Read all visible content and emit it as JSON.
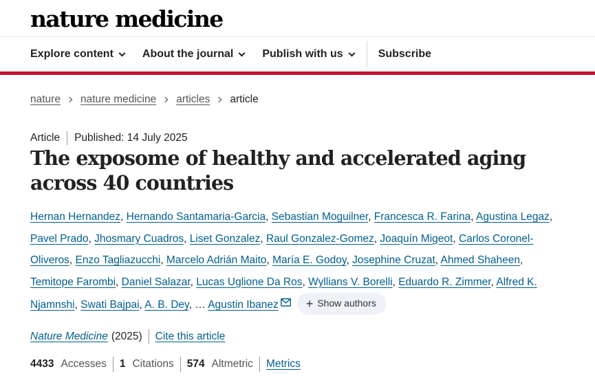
{
  "site": {
    "logo": "nature medicine"
  },
  "nav": {
    "items": [
      {
        "label": "Explore content"
      },
      {
        "label": "About the journal"
      },
      {
        "label": "Publish with us"
      }
    ],
    "subscribe": "Subscribe"
  },
  "breadcrumb": [
    "nature",
    "nature medicine",
    "articles",
    "article"
  ],
  "article": {
    "type": "Article",
    "published": "Published: 14 July 2025",
    "title": "The exposome of healthy and accelerated aging across 40 countries",
    "authors": [
      "Hernan Hernandez",
      "Hernando Santamaria-Garcia",
      "Sebastian Moguilner",
      "Francesca R. Farina",
      "Agustina Legaz",
      "Pavel Prado",
      "Jhosmary Cuadros",
      "Liset Gonzalez",
      "Raul Gonzalez-Gomez",
      "Joaquín Migeot",
      "Carlos Coronel-Oliveros",
      "Enzo Tagliazucchi",
      "Marcelo Adrián Maito",
      "María E. Godoy",
      "Josephine Cruzat",
      "Ahmed Shaheen",
      "Temitope Farombi",
      "Daniel Salazar",
      "Lucas Uglione Da Ros",
      "Wyllians V. Borelli",
      "Eduardo R. Zimmer",
      "Alfred K. Njamnshi",
      "Swati Bajpai",
      "A. B. Dey"
    ],
    "ellipsis": "…",
    "corresponding_author": "Agustin Ibanez",
    "show_authors": "Show authors",
    "journal": "Nature Medicine",
    "year": "(2025)",
    "cite": "Cite this article"
  },
  "metrics": {
    "accesses": {
      "value": "4433",
      "label": "Accesses"
    },
    "citations": {
      "value": "1",
      "label": "Citations"
    },
    "altmetric": {
      "value": "574",
      "label": "Altmetric"
    },
    "link": "Metrics"
  },
  "colors": {
    "accent_red": "#c80f2e",
    "link_blue": "#025e8d",
    "pill_bg": "#eff3f7"
  },
  "icons": [
    "chevron-down-icon",
    "chevron-right-icon",
    "mail-icon",
    "plus-icon"
  ]
}
